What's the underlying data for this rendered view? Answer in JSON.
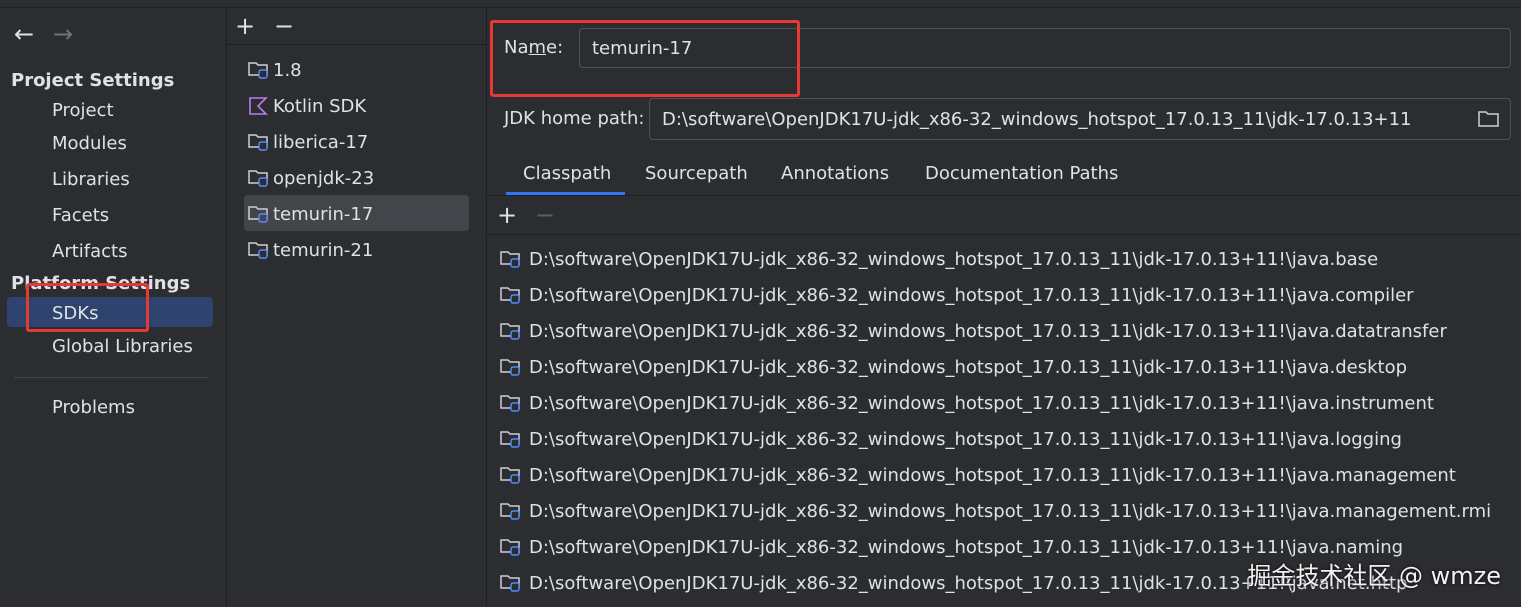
{
  "nav": {
    "back_arrow": "←",
    "forward_arrow": "→",
    "project_settings_title": "Project Settings",
    "project_items": [
      "Project",
      "Modules",
      "Libraries",
      "Facets",
      "Artifacts"
    ],
    "platform_settings_title": "Platform Settings",
    "platform_items": [
      "SDKs",
      "Global Libraries"
    ],
    "problems_label": "Problems",
    "selected": "SDKs"
  },
  "sdk_list": {
    "add_label": "+",
    "remove_label": "−",
    "items": [
      {
        "name": "1.8",
        "icon": "folder-icon"
      },
      {
        "name": "Kotlin SDK",
        "icon": "kotlin-icon"
      },
      {
        "name": "liberica-17",
        "icon": "folder-icon"
      },
      {
        "name": "openjdk-23",
        "icon": "folder-icon"
      },
      {
        "name": "temurin-17",
        "icon": "folder-icon"
      },
      {
        "name": "temurin-21",
        "icon": "folder-icon"
      }
    ],
    "selected": "temurin-17"
  },
  "detail": {
    "name_label_prefix": "Na",
    "name_label_mnemonic": "m",
    "name_label_suffix": "e:",
    "name_value": "temurin-17",
    "home_label": "JDK home path:",
    "home_value": "D:\\software\\OpenJDK17U-jdk_x86-32_windows_hotspot_17.0.13_11\\jdk-17.0.13+11",
    "tabs": [
      "Classpath",
      "Sourcepath",
      "Annotations",
      "Documentation Paths"
    ],
    "active_tab": "Classpath",
    "add_label": "+",
    "remove_label": "−",
    "classpath": [
      "D:\\software\\OpenJDK17U-jdk_x86-32_windows_hotspot_17.0.13_11\\jdk-17.0.13+11!\\java.base",
      "D:\\software\\OpenJDK17U-jdk_x86-32_windows_hotspot_17.0.13_11\\jdk-17.0.13+11!\\java.compiler",
      "D:\\software\\OpenJDK17U-jdk_x86-32_windows_hotspot_17.0.13_11\\jdk-17.0.13+11!\\java.datatransfer",
      "D:\\software\\OpenJDK17U-jdk_x86-32_windows_hotspot_17.0.13_11\\jdk-17.0.13+11!\\java.desktop",
      "D:\\software\\OpenJDK17U-jdk_x86-32_windows_hotspot_17.0.13_11\\jdk-17.0.13+11!\\java.instrument",
      "D:\\software\\OpenJDK17U-jdk_x86-32_windows_hotspot_17.0.13_11\\jdk-17.0.13+11!\\java.logging",
      "D:\\software\\OpenJDK17U-jdk_x86-32_windows_hotspot_17.0.13_11\\jdk-17.0.13+11!\\java.management",
      "D:\\software\\OpenJDK17U-jdk_x86-32_windows_hotspot_17.0.13_11\\jdk-17.0.13+11!\\java.management.rmi",
      "D:\\software\\OpenJDK17U-jdk_x86-32_windows_hotspot_17.0.13_11\\jdk-17.0.13+11!\\java.naming",
      "D:\\software\\OpenJDK17U-jdk_x86-32_windows_hotspot_17.0.13_11\\jdk-17.0.13+11!\\java.net.http"
    ]
  },
  "watermark": "掘金技术社区 @ wmze",
  "colors": {
    "background": "#2b2d30",
    "selection": "#2e436e",
    "list_selection": "#43454a",
    "accent": "#3574f0",
    "highlight_box": "#e53935",
    "jdk_badge": "#3574f0"
  }
}
